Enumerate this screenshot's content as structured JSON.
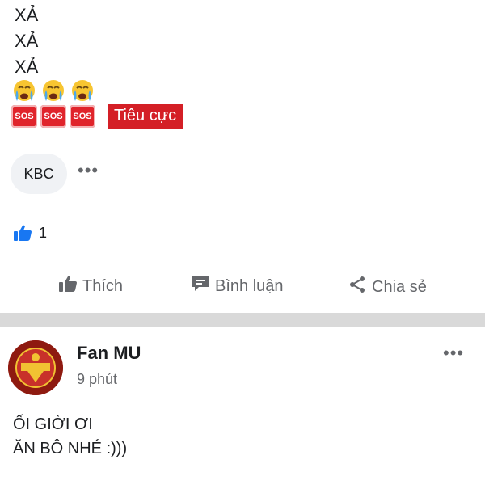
{
  "post1": {
    "lines": [
      "XẢ",
      "XẢ",
      "XẢ"
    ],
    "emoji": [
      "crying-face",
      "crying-face",
      "crying-face",
      "sos-button",
      "sos-button",
      "sos-button"
    ],
    "sos_label": "SOS",
    "sentiment_badge": "Tiêu cực",
    "sentiment_color": "#d41f26",
    "comment_chip": "KBC",
    "more_label": "•••",
    "like_count": "1",
    "actions": {
      "like": "Thích",
      "comment": "Bình luận",
      "share": "Chia sẻ"
    }
  },
  "post2": {
    "author": "Fan MU",
    "time": "9 phút",
    "more_label": "•••",
    "text_lines": [
      "ỐI GIỜI ƠI",
      "ĂN BÔ NHÉ :)))"
    ]
  },
  "colors": {
    "like_blue": "#1877f2",
    "muted": "#65676b",
    "separator": "#d9d9d9",
    "avatar_red": "#9c1b12"
  }
}
